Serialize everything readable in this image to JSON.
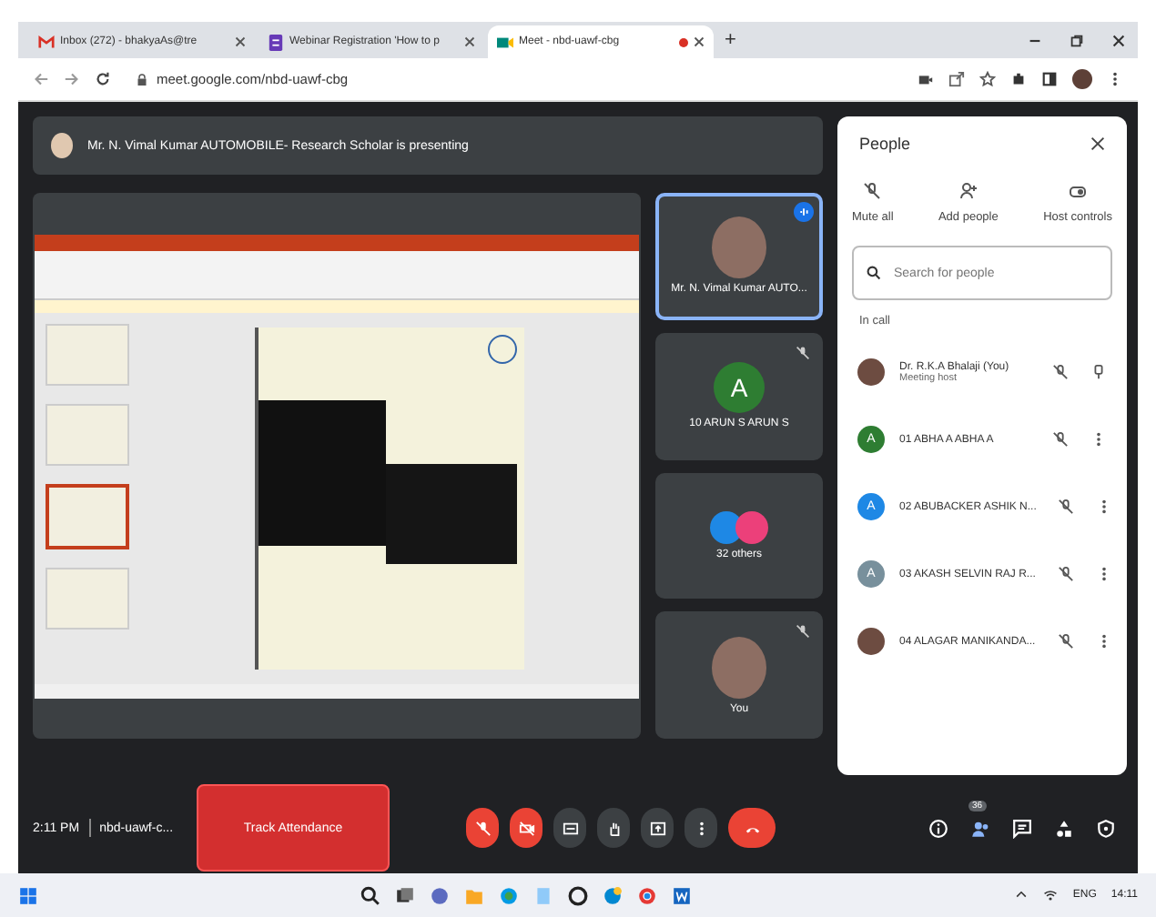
{
  "browser": {
    "tabs": [
      {
        "title": "Inbox (272) - bhakyaAs@tre",
        "selected": false
      },
      {
        "title": "Webinar Registration 'How to p",
        "selected": false
      },
      {
        "title": "Meet - nbd-uawf-cbg",
        "selected": true
      }
    ],
    "new_tab": "+",
    "url": "meet.google.com/nbd-uawf-cbg"
  },
  "meet": {
    "presenting_banner": "Mr. N. Vimal Kumar AUTOMOBILE- Research Scholar is presenting",
    "tiles": [
      {
        "kind": "photo",
        "name": "Mr. N. Vimal Kumar AUTO...",
        "speaking": true,
        "muted": false
      },
      {
        "kind": "letter",
        "letter": "A",
        "color": "#2e7d32",
        "name": "10 ARUN S ARUN S",
        "speaking": false,
        "muted": true
      },
      {
        "kind": "group",
        "name": "32 others",
        "speaking": false,
        "muted": false
      },
      {
        "kind": "photo",
        "name": "You",
        "speaking": false,
        "muted": true
      }
    ],
    "people": {
      "title": "People",
      "actions": [
        {
          "label": "Mute all"
        },
        {
          "label": "Add people"
        },
        {
          "label": "Host controls"
        }
      ],
      "search": {
        "placeholder": "Search for people"
      },
      "section": "In call",
      "participants": [
        {
          "kind": "photo",
          "name": "Dr. R.K.A Bhalaji (You)",
          "role": "Meeting host",
          "more": false
        },
        {
          "kind": "letter",
          "letter": "A",
          "color": "#2e7d32",
          "name": "01 ABHA A ABHA A",
          "more": true
        },
        {
          "kind": "letter",
          "letter": "A",
          "color": "#1e88e5",
          "name": "02 ABUBACKER ASHIK N...",
          "more": true
        },
        {
          "kind": "letter",
          "letter": "A",
          "color": "#78909c",
          "name": "03 AKASH SELVIN RAJ R...",
          "more": true
        },
        {
          "kind": "photo",
          "name": "04 ALAGAR MANIKANDA...",
          "more": true
        }
      ]
    },
    "bottom": {
      "time": "2:11 PM",
      "code": "nbd-uawf-c...",
      "track_button": "Track Attendance",
      "controls": [
        {
          "off": true
        },
        {
          "off": true
        },
        {
          "off": false
        },
        {
          "off": false
        },
        {
          "off": false
        },
        {
          "off": false
        },
        {
          "off": true
        }
      ],
      "people_count": "36"
    }
  },
  "taskbar": {
    "lang": "ENG",
    "time": "14:11"
  }
}
